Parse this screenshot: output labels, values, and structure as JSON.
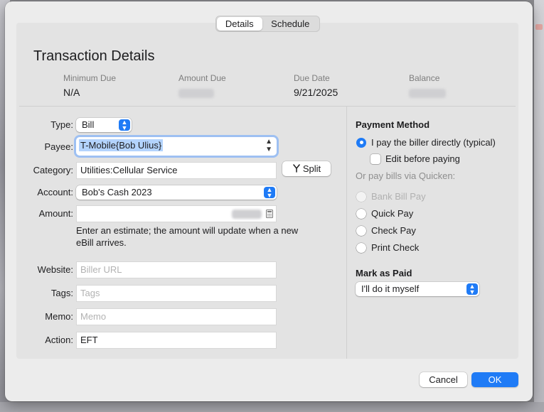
{
  "tabs": [
    {
      "label": "Details",
      "active": true
    },
    {
      "label": "Schedule",
      "active": false
    }
  ],
  "title": "Transaction Details",
  "summary": {
    "minimum_due": {
      "label": "Minimum Due",
      "value": "N/A"
    },
    "amount_due": {
      "label": "Amount Due",
      "value": ""
    },
    "due_date": {
      "label": "Due Date",
      "value": "9/21/2025"
    },
    "balance": {
      "label": "Balance",
      "value": ""
    }
  },
  "form": {
    "type": {
      "label": "Type:",
      "value": "Bill"
    },
    "payee": {
      "label": "Payee:",
      "value": "T-Mobile{Bob Ulius}"
    },
    "category": {
      "label": "Category:",
      "value": "Utilities:Cellular Service"
    },
    "split_label": "Split",
    "account": {
      "label": "Account:",
      "value": "Bob's Cash 2023"
    },
    "amount": {
      "label": "Amount:",
      "value": ""
    },
    "amount_note": "Enter an estimate; the amount will update when a new eBill arrives.",
    "website": {
      "label": "Website:",
      "placeholder": "Biller URL"
    },
    "tags": {
      "label": "Tags:",
      "placeholder": "Tags"
    },
    "memo": {
      "label": "Memo:",
      "placeholder": "Memo"
    },
    "action": {
      "label": "Action:",
      "value": "EFT"
    }
  },
  "payment_method": {
    "title": "Payment Method",
    "direct_option": "I pay the biller directly (typical)",
    "edit_before_paying": "Edit before paying",
    "or_pay_label": "Or pay bills via Quicken:",
    "options": [
      "Bank Bill Pay",
      "Quick Pay",
      "Check Pay",
      "Print Check"
    ]
  },
  "mark_as_paid": {
    "title": "Mark as Paid",
    "value": "I'll do it myself"
  },
  "buttons": {
    "cancel": "Cancel",
    "ok": "OK"
  },
  "colors": {
    "accent": "#1f7bf6",
    "panel": "#e3e3e3",
    "sheet": "#ececec"
  }
}
